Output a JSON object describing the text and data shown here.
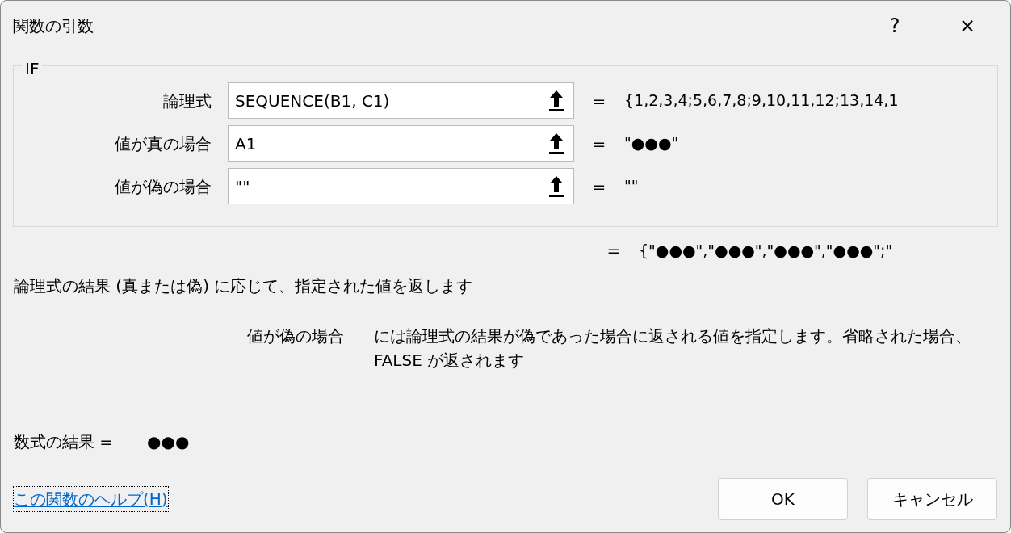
{
  "window": {
    "title": "関数の引数",
    "help_button": "?",
    "close_button": "×"
  },
  "function": {
    "name": "IF",
    "arguments": [
      {
        "label": "論理式",
        "value": "SEQUENCE(B1, C1)",
        "equals": "=",
        "result": "{1,2,3,4;5,6,7,8;9,10,11,12;13,14,1"
      },
      {
        "label": "値が真の場合",
        "value": "A1",
        "equals": "=",
        "result": "\"●●●\""
      },
      {
        "label": "値が偽の場合",
        "value": "\"\"",
        "equals": "=",
        "result": "\"\""
      }
    ]
  },
  "function_result": {
    "equals": "=",
    "value": "{\"●●●\",\"●●●\",\"●●●\",\"●●●\";\""
  },
  "description": "論理式の結果 (真または偽) に応じて、指定された値を返します",
  "argument_help": {
    "label": "値が偽の場合",
    "text": "には論理式の結果が偽であった場合に返される値を指定します。省略された場合、FALSE が返されます"
  },
  "formula_result": {
    "label": "数式の結果 =",
    "value": "●●●"
  },
  "help_link": "この関数のヘルプ(H)",
  "buttons": [
    "OK",
    "キャンセル"
  ]
}
